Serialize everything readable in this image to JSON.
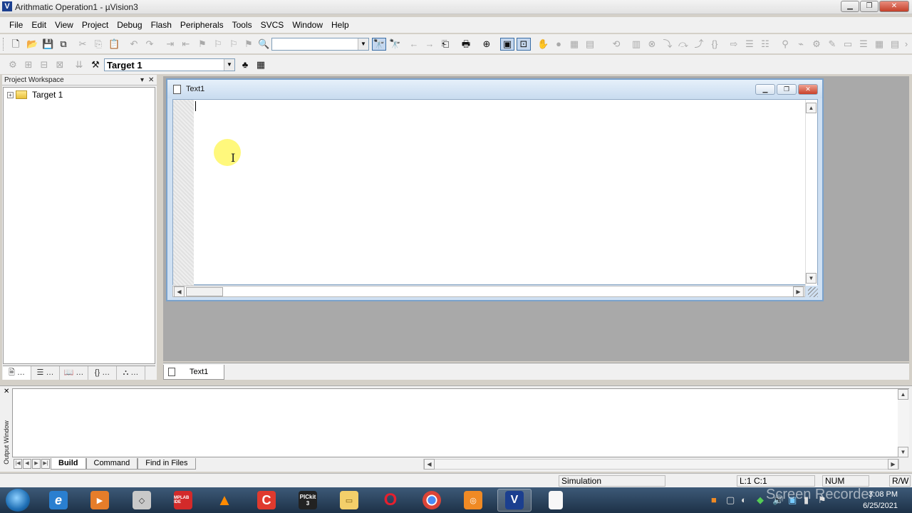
{
  "window": {
    "title": "Arithmatic Operation1 - µVision3",
    "app_icon": "V"
  },
  "menu": [
    "File",
    "Edit",
    "View",
    "Project",
    "Debug",
    "Flash",
    "Peripherals",
    "Tools",
    "SVCS",
    "Window",
    "Help"
  ],
  "toolbar": {
    "find_combo_value": "",
    "target_combo_value": "Target 1"
  },
  "workspace": {
    "title": "Project Workspace",
    "tree": [
      {
        "label": "Target 1",
        "expander": "+"
      }
    ],
    "tabs": [
      "…",
      "…",
      "…",
      "…",
      "…"
    ]
  },
  "document": {
    "title": "Text1",
    "tab_label": "Text1"
  },
  "output": {
    "side_label": "Output Window",
    "tabs": [
      "Build",
      "Command",
      "Find in Files"
    ],
    "selected_tab": "Build"
  },
  "statusbar": {
    "mode": "Simulation",
    "position": "L:1 C:1",
    "num": "NUM",
    "rw": "R/W"
  },
  "taskbar": {
    "apps": [
      {
        "name": "internet-explorer",
        "label": "e"
      },
      {
        "name": "media-player",
        "label": "▶"
      },
      {
        "name": "cube-app",
        "label": "◇"
      },
      {
        "name": "mplab-ide",
        "label": "MPLAB IDE"
      },
      {
        "name": "vlc",
        "label": "▲"
      },
      {
        "name": "c-compiler",
        "label": "C"
      },
      {
        "name": "pickit-3",
        "label": "PICkit 3"
      },
      {
        "name": "file-explorer",
        "label": "▭"
      },
      {
        "name": "opera",
        "label": "O"
      },
      {
        "name": "chrome",
        "label": "●"
      },
      {
        "name": "orange-app",
        "label": "◎"
      },
      {
        "name": "uvision",
        "label": "V"
      },
      {
        "name": "blank-document",
        "label": ""
      }
    ],
    "time": "3:08 PM",
    "date": "6/25/2021"
  },
  "watermark": "Screen Recorder",
  "colors": {
    "accent": "#3a6ea5",
    "close_red": "#c4402a",
    "taskbar": "#1d3147"
  }
}
